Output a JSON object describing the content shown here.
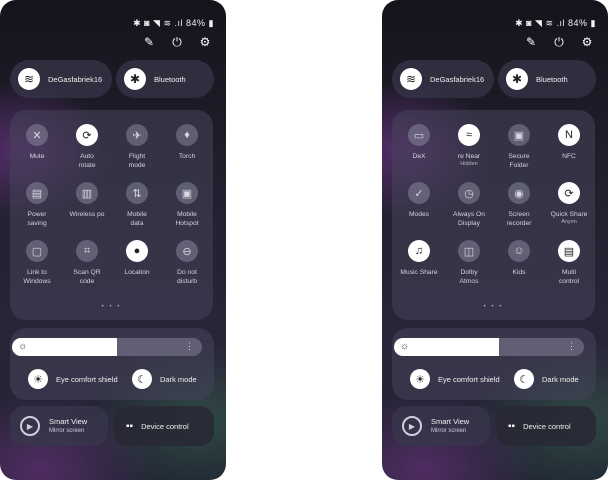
{
  "status_bar": {
    "text": "✱ ◙ ◥ ≋ .ıl 84% ▮"
  },
  "top_actions": [
    {
      "name": "pencil-icon",
      "glyph": "✎"
    },
    {
      "name": "power-icon",
      "glyph": "⏻"
    },
    {
      "name": "gear-icon",
      "glyph": "⚙"
    }
  ],
  "wifi": {
    "label": "DeGasfabriek16"
  },
  "bluetooth": {
    "label": "Bluetooth"
  },
  "left_tiles": [
    {
      "label": "Mute",
      "glyph": "✕",
      "on": false
    },
    {
      "label": "Auto\nrotate",
      "glyph": "⟳",
      "on": true
    },
    {
      "label": "Flight\nmode",
      "glyph": "✈",
      "on": false
    },
    {
      "label": "Torch",
      "glyph": "♦",
      "on": false
    },
    {
      "label": "Power\nsaving",
      "glyph": "▤",
      "on": false
    },
    {
      "label": "Wireless po",
      "glyph": "▥",
      "on": false
    },
    {
      "label": "Mobile\ndata",
      "glyph": "⇅",
      "on": false
    },
    {
      "label": "Mobile\nHotspot",
      "glyph": "▣",
      "on": false
    },
    {
      "label": "Link to\nWindows",
      "glyph": "▢",
      "on": false
    },
    {
      "label": "Scan QR\ncode",
      "glyph": "⌗",
      "on": false
    },
    {
      "label": "Location",
      "glyph": "●",
      "on": true
    },
    {
      "label": "Do not\ndisturb",
      "glyph": "⊖",
      "on": false
    }
  ],
  "right_tiles": [
    {
      "label": "DeX",
      "glyph": "▭",
      "on": false,
      "sub": ""
    },
    {
      "label": "re      Near",
      "glyph": "≈",
      "on": true,
      "sub": "Hidden"
    },
    {
      "label": "Secure\nFolder",
      "glyph": "▣",
      "on": false,
      "sub": ""
    },
    {
      "label": "NFC",
      "glyph": "N",
      "on": true,
      "sub": ""
    },
    {
      "label": "Modes",
      "glyph": "✓",
      "on": false,
      "sub": ""
    },
    {
      "label": "Always On\nDisplay",
      "glyph": "◷",
      "on": false,
      "sub": ""
    },
    {
      "label": "Screen\nrecorder",
      "glyph": "◉",
      "on": false,
      "sub": ""
    },
    {
      "label": "Quick Share",
      "glyph": "⟳",
      "on": true,
      "sub": "Anyon"
    },
    {
      "label": "Music Share",
      "glyph": "♫",
      "on": true,
      "sub": ""
    },
    {
      "label": "Dolby\nAtmos",
      "glyph": "◫",
      "on": false,
      "sub": ""
    },
    {
      "label": "Kids",
      "glyph": "☺",
      "on": false,
      "sub": ""
    },
    {
      "label": "Multi\ncontrol",
      "glyph": "▤",
      "on": true,
      "sub": ""
    }
  ],
  "pagination": {
    "text": "• • •"
  },
  "brightness": {
    "level": 0.55,
    "sun": "☼",
    "more": "⋮"
  },
  "eye_comfort": {
    "label": "Eye comfort shield",
    "glyph": "☀"
  },
  "dark_mode": {
    "label": "Dark mode",
    "glyph": "☾"
  },
  "smart_view": {
    "title": "Smart View",
    "subtitle": "Mirror screen",
    "glyph": "▶"
  },
  "device_control": {
    "label": "Device control",
    "glyph": "▪▪"
  }
}
